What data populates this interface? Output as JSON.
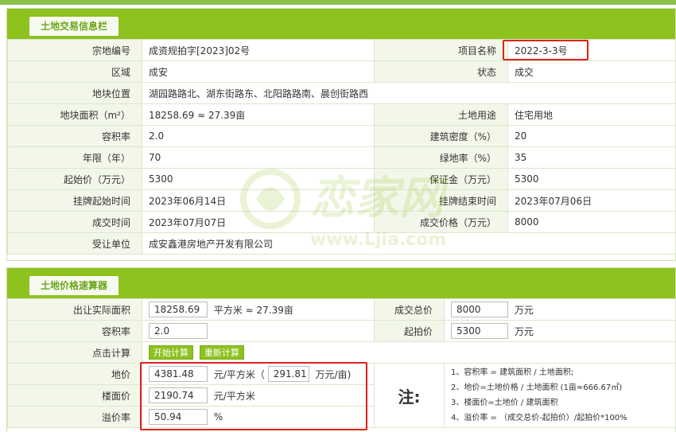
{
  "info_panel": {
    "title": "土地交易信息栏",
    "rows": [
      {
        "l1": "宗地编号",
        "v1": "成资规拍字[2023]02号",
        "l2": "项目名称",
        "v2": "2022-3-3号"
      },
      {
        "l1": "区域",
        "v1": "成安",
        "l2": "状态",
        "v2": "成交"
      },
      {
        "l1": "地块位置",
        "v1": "湖园路路北、湖东街路东、北阳路路南、晨创街路西"
      },
      {
        "l1": "地块面积（m²）",
        "v1": "18258.69 ≈ 27.39亩",
        "l2": "土地用途",
        "v2": "住宅用地"
      },
      {
        "l1": "容积率",
        "v1": "2.0",
        "l2": "建筑密度（%）",
        "v2": "20"
      },
      {
        "l1": "年限（年）",
        "v1": "70",
        "l2": "绿地率（%）",
        "v2": "35"
      },
      {
        "l1": "起始价（万元）",
        "v1": "5300",
        "l2": "保证金（万元）",
        "v2": "5300"
      },
      {
        "l1": "挂牌起始时间",
        "v1": "2023年06月14日",
        "l2": "挂牌结束时间",
        "v2": "2023年07月06日"
      },
      {
        "l1": "成交时间",
        "v1": "2023年07月07日",
        "l2": "成交价格（万元）",
        "v2": "8000"
      },
      {
        "l1": "受让单位",
        "v1": "成安鑫港房地产开发有限公司"
      }
    ]
  },
  "calc_panel": {
    "title": "土地价格速算器",
    "area_label": "出让实际面积",
    "area_value": "18258.69",
    "area_unit": "平方米 ≈  27.39亩",
    "total_label": "成交总价",
    "total_value": "8000",
    "total_unit": "万元",
    "far_label": "容积率",
    "far_value": "2.0",
    "start_label": "起拍价",
    "start_value": "5300",
    "start_unit": "万元",
    "click_label": "点击计算",
    "btn_start": "开始计算",
    "btn_reset": "重新计算",
    "land_price_label": "地价",
    "land_price_value": "4381.48",
    "land_price_unit": "元/平方米（",
    "land_price_mu_value": "291.81",
    "land_price_mu_unit": "万元/亩)",
    "floor_price_label": "楼面价",
    "floor_price_value": "2190.74",
    "floor_price_unit": "元/平方米",
    "premium_label": "溢价率",
    "premium_value": "50.94",
    "premium_unit": "%",
    "note_label": "注:",
    "notes": [
      "1、容积率 = 建筑面积 / 土地面积;",
      "2、地价=土地价格 / 土地面积  (1亩≈666.67㎡)",
      "3、楼面价=土地价 / 建筑面积",
      "4、溢价率 = （成交总价-起拍价）/起拍价*100%"
    ]
  },
  "watermark_text": "www.Ljia.com",
  "colors": {
    "accent": "#8dc21f",
    "highlight": "#e0211b"
  }
}
